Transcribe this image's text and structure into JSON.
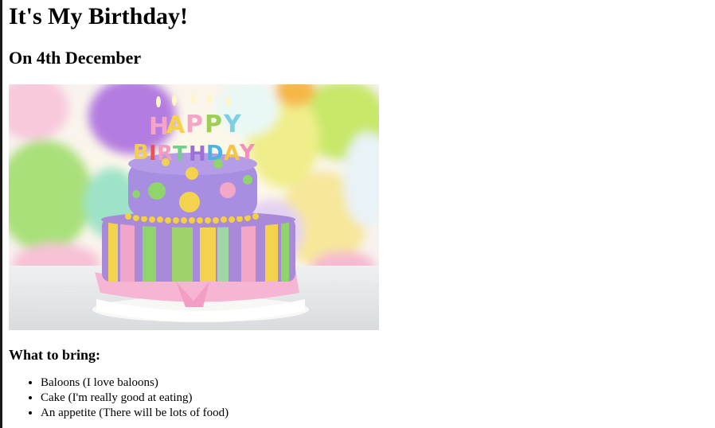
{
  "page": {
    "title": "It's My Birthday!",
    "subtitle": "On 4th December",
    "image": {
      "letters_top": "HAPPY",
      "letters_bottom": "BIRTHDAY"
    },
    "bring_heading": "What to bring:",
    "bring_items": [
      "Baloons (I love baloons)",
      "Cake (I'm really good at eating)",
      "An appetite (There will be lots of food)"
    ]
  },
  "colors": {
    "background": "#ffffff",
    "text": "#000000",
    "cake_purple": "#9b7fd0",
    "cake_pink": "#f2a9cf",
    "cake_yellow": "#f3d250",
    "cake_green": "#8fce6e"
  }
}
